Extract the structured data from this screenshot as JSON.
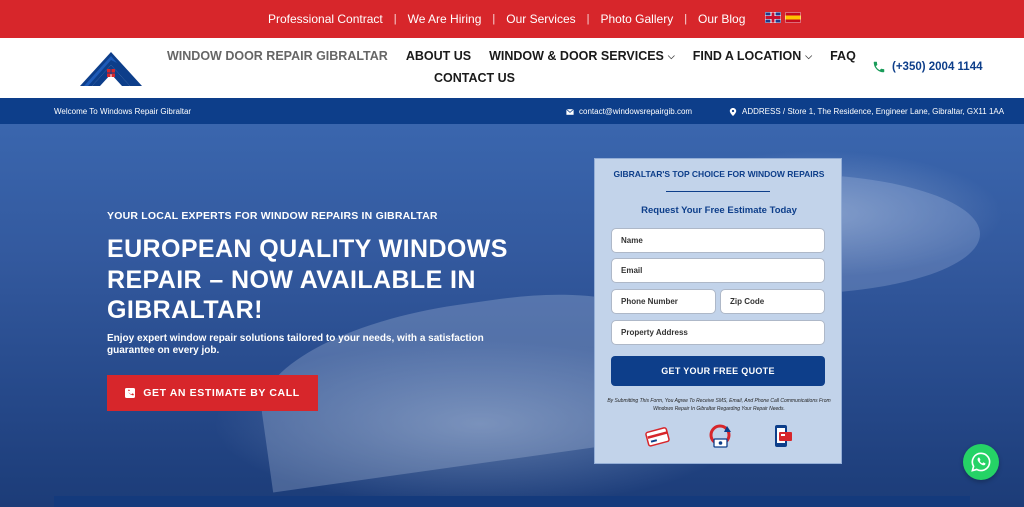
{
  "topbar": {
    "links": [
      "Professional Contract",
      "We Are Hiring",
      "Our Services",
      "Photo Gallery",
      "Our Blog"
    ],
    "separator": "|",
    "languages": [
      "English",
      "Español"
    ]
  },
  "header": {
    "nav": {
      "home": "WINDOW DOOR REPAIR GIBRALTAR",
      "about": "ABOUT US",
      "services": "WINDOW & DOOR SERVICES",
      "location": "FIND A LOCATION",
      "faq": "FAQ",
      "contact": "CONTACT US"
    },
    "phone": "(+350) 2004 1144"
  },
  "infobar": {
    "welcome": "Welcome To Windows Repair Gibraltar",
    "email": "contact@windowsrepairgib.com",
    "address": "ADDRESS / Store 1, The Residence, Engineer Lane, Gibraltar, GX11 1AA"
  },
  "hero": {
    "eyebrow": "YOUR LOCAL EXPERTS FOR WINDOW REPAIRS IN GIBRALTAR",
    "headline": "EUROPEAN QUALITY WINDOWS REPAIR – NOW AVAILABLE IN GIBRALTAR!",
    "subtext": "Enjoy expert window repair solutions tailored to your needs, with a satisfaction guarantee on every job.",
    "cta": "GET AN ESTIMATE BY CALL"
  },
  "form": {
    "title": "GIBRALTAR'S TOP CHOICE FOR WINDOW REPAIRS",
    "subtitle": "Request Your Free Estimate Today",
    "placeholders": {
      "name": "Name",
      "email": "Email",
      "phone": "Phone Number",
      "zip": "Zip Code",
      "address": "Property Address"
    },
    "submit": "GET YOUR FREE QUOTE",
    "disclaimer": "By Submitting This Form, You Agree To Receive SMS, Email, And Phone Call Communications From Windows Repair In Gibraltar Regarding Your Repair Needs."
  },
  "icons": {
    "phone": "phone-icon",
    "email": "envelope-icon",
    "address": "map-pin-icon",
    "whatsapp": "whatsapp-icon"
  },
  "colors": {
    "brand_red": "#d7262b",
    "brand_blue": "#0d3e8a",
    "phone_green": "#1a9c5a",
    "whatsapp_green": "#25d366"
  }
}
